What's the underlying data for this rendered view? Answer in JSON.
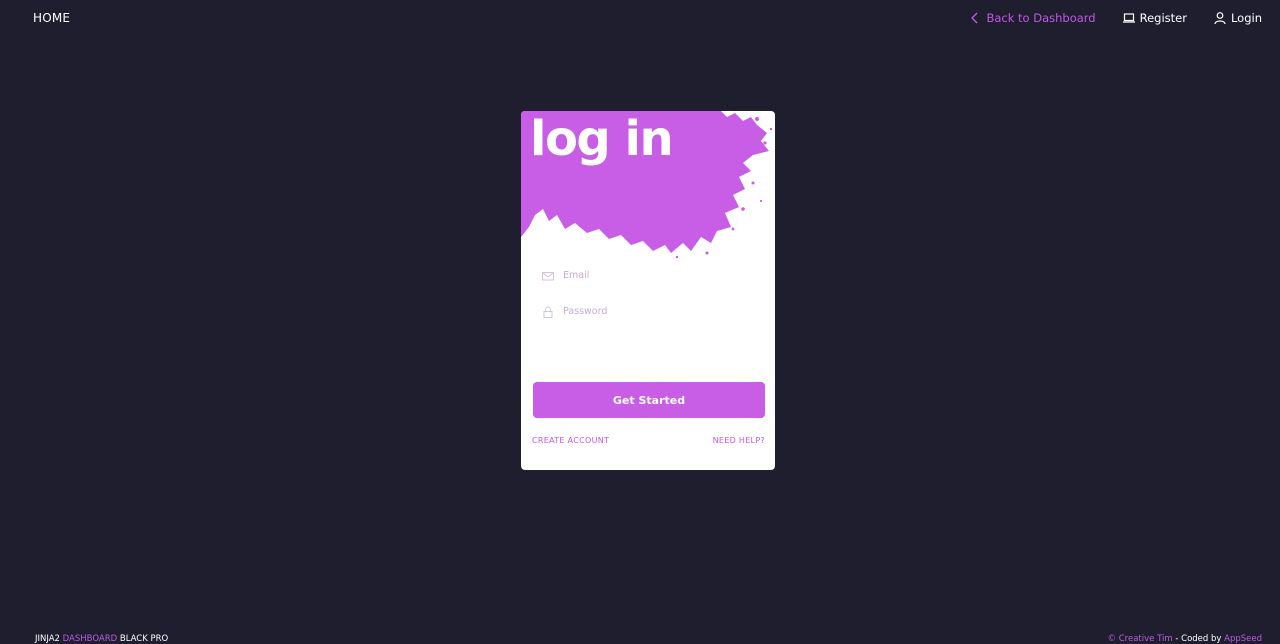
{
  "navbar": {
    "brand": "HOME",
    "links": [
      {
        "label": "Back to Dashboard",
        "icon": "chevron-left-icon"
      },
      {
        "label": "Register",
        "icon": "laptop-icon"
      },
      {
        "label": "Login",
        "icon": "user-icon"
      }
    ]
  },
  "card": {
    "title": "log in",
    "email_placeholder": "Email",
    "password_placeholder": "Password",
    "submit_label": "Get Started",
    "create_account_label": "Create Account",
    "need_help_label": "Need Help?"
  },
  "footer": {
    "left_prefix": "JINJA2 ",
    "left_accent": "DASHBOARD",
    "left_suffix": " BLACK PRO",
    "right_link": "© Creative Tim",
    "right_separator": " - Coded by ",
    "right_author": "AppSeed"
  },
  "colors": {
    "background": "#1e1e2f",
    "accent": "#c85de6",
    "card": "#ffffff"
  }
}
